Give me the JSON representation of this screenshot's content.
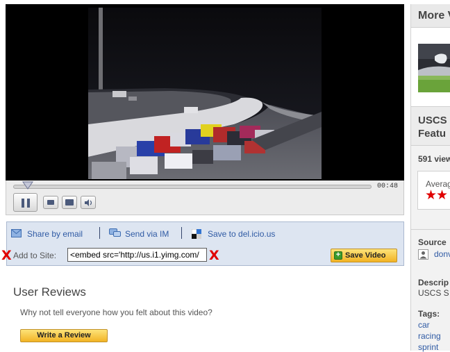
{
  "player": {
    "time": "00:48",
    "progress_fraction": 0.04
  },
  "share": {
    "email_label": "Share by email",
    "im_label": "Send via IM",
    "delicious_label": "Save to del.icio.us",
    "add_to_site_label": "Add to Site:",
    "embed_value": "<embed src='http://us.i1.yimg.com/",
    "save_video_label": "Save Video"
  },
  "reviews": {
    "heading": "User Reviews",
    "prompt": "Why not tell everyone how you felt about this video?",
    "write_review_label": "Write a Review"
  },
  "sidebar": {
    "more_title": "More V",
    "video_title_line1": "USCS",
    "video_title_line2": "Featu",
    "views": "591 view",
    "rating_label": "Averag",
    "stars": "★★",
    "source_label": "Source",
    "source_user": "donv",
    "description_label": "Descrip",
    "description_text": "USCS S",
    "tags_label": "Tags:",
    "tags": [
      "car",
      "racing",
      "sprint"
    ]
  },
  "colors": {
    "accent_red": "#e00000",
    "link_blue": "#2f5aa4",
    "button_gold": "#f2b324",
    "share_panel_bg": "#dde5f1"
  }
}
